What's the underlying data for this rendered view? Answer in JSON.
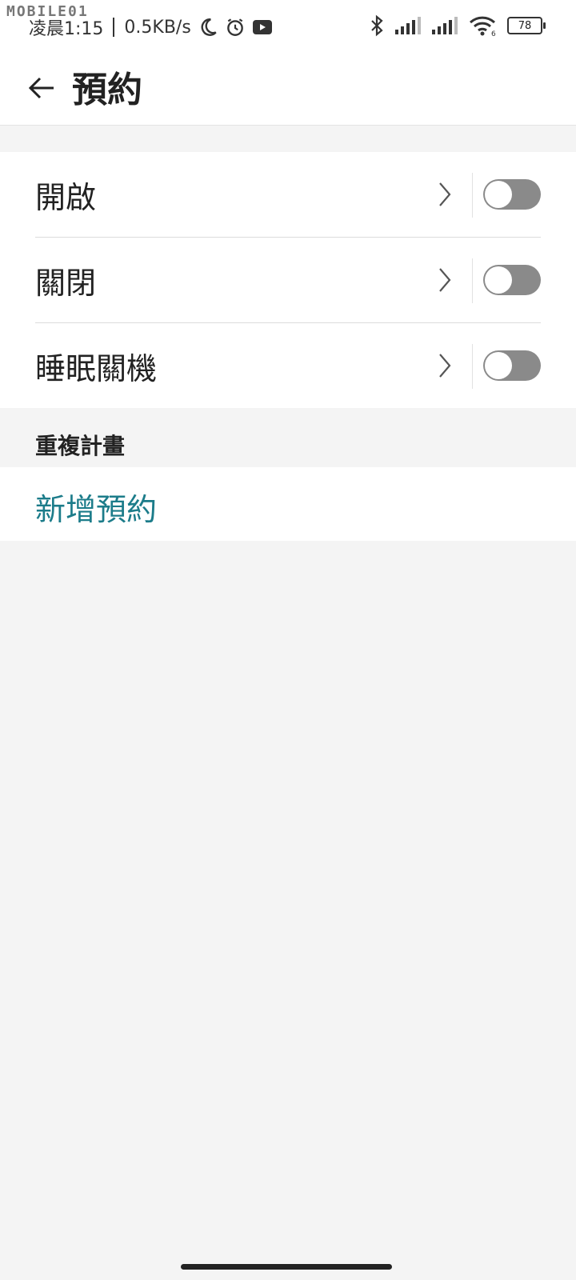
{
  "watermark": "MOBILE01",
  "status_bar": {
    "time": "凌晨1:15",
    "net_speed": "0.5KB/s",
    "battery": "78",
    "wifi_badge": "6",
    "icons": [
      "moon-icon",
      "alarm-icon",
      "youtube-icon",
      "bluetooth-icon",
      "signal-icon",
      "signal-icon",
      "wifi-icon",
      "battery-icon"
    ]
  },
  "header": {
    "title": "預約"
  },
  "schedule_items": [
    {
      "label": "開啟",
      "enabled": false
    },
    {
      "label": "關閉",
      "enabled": false
    },
    {
      "label": "睡眠關機",
      "enabled": false
    }
  ],
  "repeat_section": {
    "title": "重複計畫",
    "add_label": "新增預約"
  },
  "colors": {
    "accent": "#1c7c8a",
    "toggle_off": "#8a8a8a",
    "background": "#f4f4f4"
  }
}
